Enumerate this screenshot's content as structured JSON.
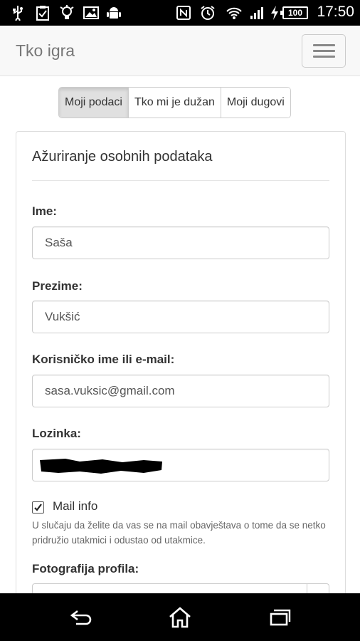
{
  "status_bar": {
    "time": "17:50",
    "battery": "100",
    "icons": [
      "usb-icon",
      "clipboard-icon",
      "bulb-icon",
      "image-icon",
      "android-icon",
      "nfc-icon",
      "alarm-icon",
      "wifi-icon",
      "signal-icon",
      "charging-icon"
    ]
  },
  "app": {
    "brand": "Tko igra"
  },
  "tabs": [
    {
      "label": "Moji podaci",
      "active": true
    },
    {
      "label": "Tko mi je dužan",
      "active": false
    },
    {
      "label": "Moji dugovi",
      "active": false
    }
  ],
  "form": {
    "title": "Ažuriranje osobnih podataka",
    "first_name": {
      "label": "Ime:",
      "value": "Saša"
    },
    "last_name": {
      "label": "Prezime:",
      "value": "Vukšić"
    },
    "username": {
      "label": "Korisničko ime ili e-mail:",
      "value": "sasa.vuksic@gmail.com"
    },
    "password": {
      "label": "Lozinka:"
    },
    "mail_info": {
      "label": "Mail info",
      "checked": true,
      "help": "U slučaju da želite da vas se na mail obavještava o tome da se netko pridružio utakmici i odustao od utakmice."
    },
    "photo": {
      "label": "Fotografija profila:"
    }
  },
  "nav_buttons": [
    "back-icon",
    "home-icon",
    "recents-icon"
  ]
}
